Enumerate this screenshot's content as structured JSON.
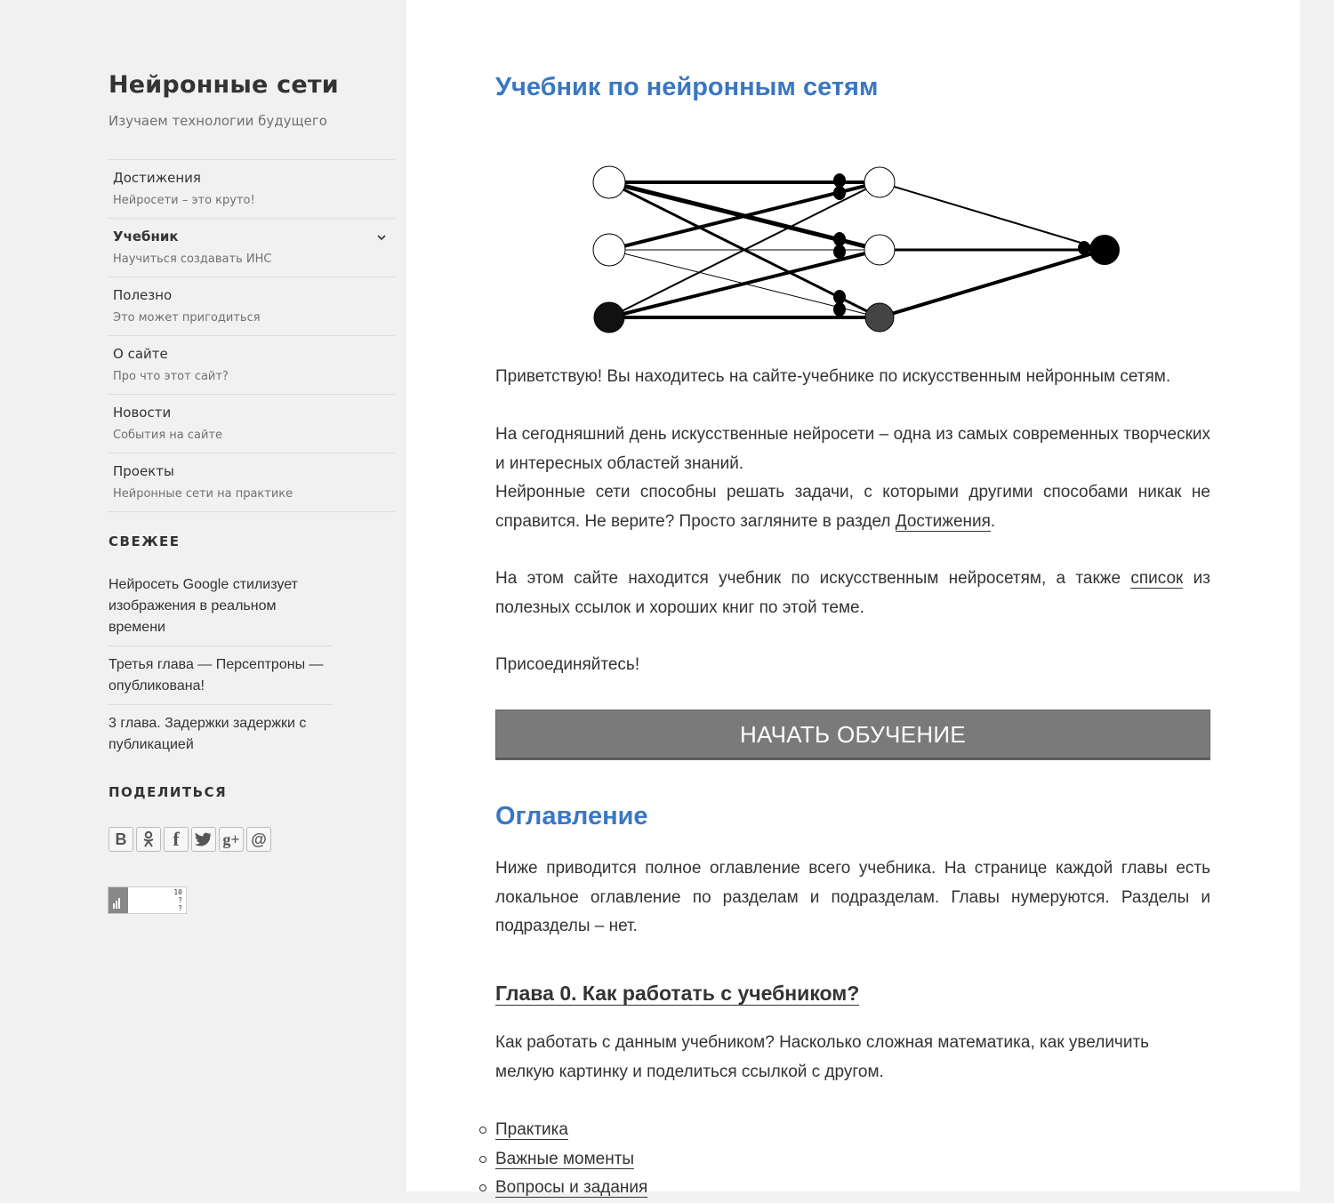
{
  "site": {
    "title": "Нейронные сети",
    "description": "Изучаем технологии будущего"
  },
  "nav": [
    {
      "label": "Достижения",
      "sub": "Нейросети – это круто!"
    },
    {
      "label": "Учебник",
      "sub": "Научиться создавать ИНС",
      "icon": "chevron-down-icon"
    },
    {
      "label": "Полезно",
      "sub": "Это может пригодиться"
    },
    {
      "label": "О сайте",
      "sub": "Про что этот сайт?"
    },
    {
      "label": "Новости",
      "sub": "События на сайте"
    },
    {
      "label": "Проекты",
      "sub": "Нейронные сети на практике"
    }
  ],
  "recent": {
    "title": "СВЕЖЕЕ",
    "items": [
      "Нейросеть Google стилизует изображения в реальном времени",
      "Третья глава — Персептроны — опубликована!",
      "3 глава. Задержки задержки с публикацией"
    ]
  },
  "share": {
    "title": "ПОДЕЛИТЬСЯ",
    "buttons": [
      {
        "icon": "vk-icon",
        "glyph": "В"
      },
      {
        "icon": "odnoklassniki-icon",
        "glyph": "ok"
      },
      {
        "icon": "facebook-icon",
        "glyph": "f"
      },
      {
        "icon": "twitter-icon",
        "glyph": "t"
      },
      {
        "icon": "google-plus-icon",
        "glyph": "g+"
      },
      {
        "icon": "mail-icon",
        "glyph": "@"
      }
    ]
  },
  "counter": {
    "line1": "10",
    "line2": "?",
    "line3": "?"
  },
  "post": {
    "title": "Учебник по нейронным сетям",
    "p1": "Приветствую! Вы находитесь на сайте-учебнике по искусственным нейронным сетям.",
    "p2a": "На сегодняшний день искусственные нейросети – одна из самых современных творческих и интересных областей знаний.",
    "p2b_pre": "Нейронные сети способны решать задачи, с которыми другими способами никак не справится. Не верите? Просто загляните в раздел ",
    "p2b_link": "Достижения",
    "p2b_post": ".",
    "p3_pre": "На этом сайте находится учебник по искусственным нейросетям, а также ",
    "p3_link": "список",
    "p3_post": " из полезных ссылок и хороших книг по этой теме.",
    "p4": "Присоединяйтесь!",
    "start_button": "НАЧАТЬ ОБУЧЕНИЕ",
    "toc_title": "Оглавление",
    "toc_intro": "Ниже приводится полное оглавление всего учебника. На странице каждой главы есть локальное оглавление по разделам и подразделам. Главы нумеруются. Разделы и подразделы – нет.",
    "chapter0_title": "Глава 0. Как работать с учебником?",
    "chapter0_desc": "Как работать с данным учебником? Насколько сложная математика, как увеличить мелкую картинку и поделиться ссылкой с другом.",
    "chapter0_items": [
      "Практика",
      "Важные моменты",
      "Вопросы и задания"
    ]
  },
  "colors": {
    "accent": "#3a77c0",
    "sidebar_bg": "#f1f1f1",
    "button_bg": "#7a7a7a"
  }
}
